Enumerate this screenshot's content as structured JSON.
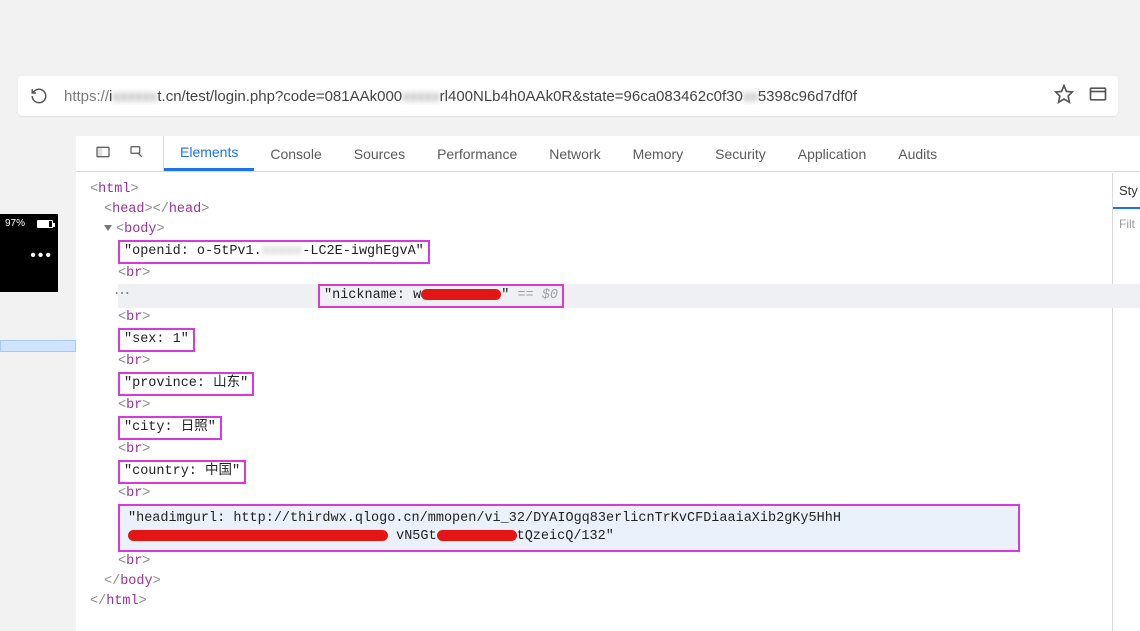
{
  "url": {
    "scheme": "https://",
    "host_pre": "i",
    "host_blur": "xxxxxx",
    "host_post": "t.cn/test/login.php?code=081AAk000",
    "mid_blur": "xxxxx",
    "mid_post": "rl400NLb4h0AAk0R&state=96ca083462c0f30",
    "tail_blur": "xx",
    "tail_post": "5398c96d7df0f"
  },
  "devtools": {
    "tabs": [
      "Elements",
      "Console",
      "Sources",
      "Performance",
      "Network",
      "Memory",
      "Security",
      "Application",
      "Audits"
    ],
    "active_tab": "Elements",
    "styles_label": "Sty",
    "filter_label": "Filt"
  },
  "phone": {
    "battery": "97%"
  },
  "dom": {
    "html_open": "html",
    "head": "head",
    "body": "body",
    "openid_pre": "\"openid: o-5tPv1.",
    "openid_blur": "xxxxx",
    "openid_post": "-LC2E-iwghEgvA\"",
    "br": "br",
    "nickname_pre": "\"nickname: w",
    "nickname_post": "\"",
    "eq0": " == $0",
    "sex": "\"sex: 1\"",
    "province": "\"province: 山东\"",
    "city": "\"city: 日照\"",
    "country": "\"country: 中国\"",
    "headimgurl_pre": "\"headimgurl:\nhttp://thirdwx.qlogo.cn/mmopen/vi_32/DYAIOgq83erlicnTrKvCFDiaaiaXib2gKy5HhH",
    "headimgurl_mid1": "\nvN5Gt",
    "headimgurl_post": "tQzeicQ/132\"",
    "body_close": "body",
    "html_close": "html"
  }
}
